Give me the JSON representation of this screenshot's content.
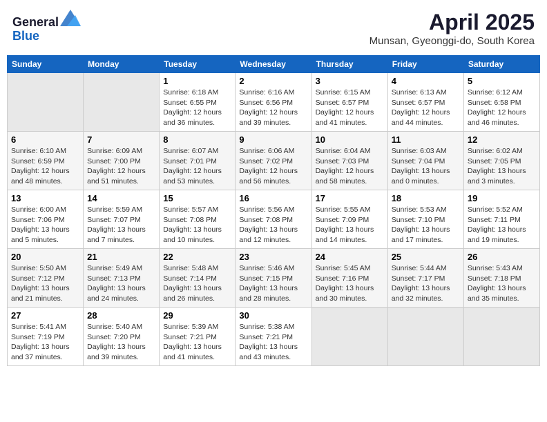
{
  "header": {
    "logo_line1": "General",
    "logo_line2": "Blue",
    "title": "April 2025",
    "subtitle": "Munsan, Gyeonggi-do, South Korea"
  },
  "weekdays": [
    "Sunday",
    "Monday",
    "Tuesday",
    "Wednesday",
    "Thursday",
    "Friday",
    "Saturday"
  ],
  "weeks": [
    [
      {
        "day": "",
        "detail": ""
      },
      {
        "day": "",
        "detail": ""
      },
      {
        "day": "1",
        "detail": "Sunrise: 6:18 AM\nSunset: 6:55 PM\nDaylight: 12 hours and 36 minutes."
      },
      {
        "day": "2",
        "detail": "Sunrise: 6:16 AM\nSunset: 6:56 PM\nDaylight: 12 hours and 39 minutes."
      },
      {
        "day": "3",
        "detail": "Sunrise: 6:15 AM\nSunset: 6:57 PM\nDaylight: 12 hours and 41 minutes."
      },
      {
        "day": "4",
        "detail": "Sunrise: 6:13 AM\nSunset: 6:57 PM\nDaylight: 12 hours and 44 minutes."
      },
      {
        "day": "5",
        "detail": "Sunrise: 6:12 AM\nSunset: 6:58 PM\nDaylight: 12 hours and 46 minutes."
      }
    ],
    [
      {
        "day": "6",
        "detail": "Sunrise: 6:10 AM\nSunset: 6:59 PM\nDaylight: 12 hours and 48 minutes."
      },
      {
        "day": "7",
        "detail": "Sunrise: 6:09 AM\nSunset: 7:00 PM\nDaylight: 12 hours and 51 minutes."
      },
      {
        "day": "8",
        "detail": "Sunrise: 6:07 AM\nSunset: 7:01 PM\nDaylight: 12 hours and 53 minutes."
      },
      {
        "day": "9",
        "detail": "Sunrise: 6:06 AM\nSunset: 7:02 PM\nDaylight: 12 hours and 56 minutes."
      },
      {
        "day": "10",
        "detail": "Sunrise: 6:04 AM\nSunset: 7:03 PM\nDaylight: 12 hours and 58 minutes."
      },
      {
        "day": "11",
        "detail": "Sunrise: 6:03 AM\nSunset: 7:04 PM\nDaylight: 13 hours and 0 minutes."
      },
      {
        "day": "12",
        "detail": "Sunrise: 6:02 AM\nSunset: 7:05 PM\nDaylight: 13 hours and 3 minutes."
      }
    ],
    [
      {
        "day": "13",
        "detail": "Sunrise: 6:00 AM\nSunset: 7:06 PM\nDaylight: 13 hours and 5 minutes."
      },
      {
        "day": "14",
        "detail": "Sunrise: 5:59 AM\nSunset: 7:07 PM\nDaylight: 13 hours and 7 minutes."
      },
      {
        "day": "15",
        "detail": "Sunrise: 5:57 AM\nSunset: 7:08 PM\nDaylight: 13 hours and 10 minutes."
      },
      {
        "day": "16",
        "detail": "Sunrise: 5:56 AM\nSunset: 7:08 PM\nDaylight: 13 hours and 12 minutes."
      },
      {
        "day": "17",
        "detail": "Sunrise: 5:55 AM\nSunset: 7:09 PM\nDaylight: 13 hours and 14 minutes."
      },
      {
        "day": "18",
        "detail": "Sunrise: 5:53 AM\nSunset: 7:10 PM\nDaylight: 13 hours and 17 minutes."
      },
      {
        "day": "19",
        "detail": "Sunrise: 5:52 AM\nSunset: 7:11 PM\nDaylight: 13 hours and 19 minutes."
      }
    ],
    [
      {
        "day": "20",
        "detail": "Sunrise: 5:50 AM\nSunset: 7:12 PM\nDaylight: 13 hours and 21 minutes."
      },
      {
        "day": "21",
        "detail": "Sunrise: 5:49 AM\nSunset: 7:13 PM\nDaylight: 13 hours and 24 minutes."
      },
      {
        "day": "22",
        "detail": "Sunrise: 5:48 AM\nSunset: 7:14 PM\nDaylight: 13 hours and 26 minutes."
      },
      {
        "day": "23",
        "detail": "Sunrise: 5:46 AM\nSunset: 7:15 PM\nDaylight: 13 hours and 28 minutes."
      },
      {
        "day": "24",
        "detail": "Sunrise: 5:45 AM\nSunset: 7:16 PM\nDaylight: 13 hours and 30 minutes."
      },
      {
        "day": "25",
        "detail": "Sunrise: 5:44 AM\nSunset: 7:17 PM\nDaylight: 13 hours and 32 minutes."
      },
      {
        "day": "26",
        "detail": "Sunrise: 5:43 AM\nSunset: 7:18 PM\nDaylight: 13 hours and 35 minutes."
      }
    ],
    [
      {
        "day": "27",
        "detail": "Sunrise: 5:41 AM\nSunset: 7:19 PM\nDaylight: 13 hours and 37 minutes."
      },
      {
        "day": "28",
        "detail": "Sunrise: 5:40 AM\nSunset: 7:20 PM\nDaylight: 13 hours and 39 minutes."
      },
      {
        "day": "29",
        "detail": "Sunrise: 5:39 AM\nSunset: 7:21 PM\nDaylight: 13 hours and 41 minutes."
      },
      {
        "day": "30",
        "detail": "Sunrise: 5:38 AM\nSunset: 7:21 PM\nDaylight: 13 hours and 43 minutes."
      },
      {
        "day": "",
        "detail": ""
      },
      {
        "day": "",
        "detail": ""
      },
      {
        "day": "",
        "detail": ""
      }
    ]
  ]
}
